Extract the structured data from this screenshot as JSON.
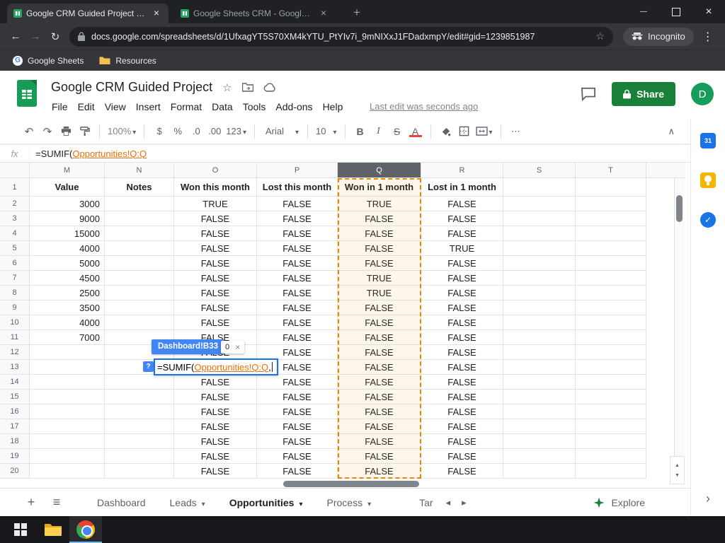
{
  "browser": {
    "tab1": "Google CRM Guided Project - Go",
    "tab2": "Google Sheets CRM - Google Sh",
    "url": "docs.google.com/spreadsheets/d/1UfxagYT5S70XM4kYTU_PtYIv7i_9mNIXxJ1FDadxmpY/edit#gid=1239851987",
    "incognito": "Incognito",
    "bookmark1": "Google Sheets",
    "bookmark2": "Resources"
  },
  "header": {
    "title": "Google CRM Guided Project",
    "menus": [
      "File",
      "Edit",
      "View",
      "Insert",
      "Format",
      "Data",
      "Tools",
      "Add-ons",
      "Help"
    ],
    "last_edit": "Last edit was seconds ago",
    "share": "Share",
    "avatar": "D"
  },
  "toolbar": {
    "zoom": "100%",
    "currency": "$",
    "percent": "%",
    "dec0": ".0",
    "dec00": ".00",
    "fmt123": "123",
    "font": "Arial",
    "size": "10",
    "bold": "B",
    "italic": "I",
    "strike": "S",
    "textcolor": "A",
    "more": "⋯"
  },
  "formula": {
    "fx": "fx",
    "prefix": "=SUMIF(",
    "ref": "Opportunities!Q:Q"
  },
  "editor": {
    "chip": "Dashboard!B33",
    "value": "0",
    "close": "×",
    "help": "?",
    "prefix": "=SUMIF(",
    "ref": "Opportunities!Q:Q",
    "suffix": ","
  },
  "grid": {
    "cols": [
      "M",
      "N",
      "O",
      "P",
      "Q",
      "R",
      "S",
      "T"
    ],
    "sel": "Q",
    "headers": [
      "Value",
      "Notes",
      "Won this month",
      "Lost this month",
      "Won in 1 month",
      "Lost in 1 month",
      "",
      ""
    ],
    "rows": [
      [
        2,
        "3000",
        "",
        "TRUE",
        "FALSE",
        "TRUE",
        "FALSE",
        "",
        ""
      ],
      [
        3,
        "9000",
        "",
        "FALSE",
        "FALSE",
        "FALSE",
        "FALSE",
        "",
        ""
      ],
      [
        4,
        "15000",
        "",
        "FALSE",
        "FALSE",
        "FALSE",
        "FALSE",
        "",
        ""
      ],
      [
        5,
        "4000",
        "",
        "FALSE",
        "FALSE",
        "FALSE",
        "TRUE",
        "",
        ""
      ],
      [
        6,
        "5000",
        "",
        "FALSE",
        "FALSE",
        "FALSE",
        "FALSE",
        "",
        ""
      ],
      [
        7,
        "4500",
        "",
        "FALSE",
        "FALSE",
        "TRUE",
        "FALSE",
        "",
        ""
      ],
      [
        8,
        "2500",
        "",
        "FALSE",
        "FALSE",
        "TRUE",
        "FALSE",
        "",
        ""
      ],
      [
        9,
        "3500",
        "",
        "FALSE",
        "FALSE",
        "FALSE",
        "FALSE",
        "",
        ""
      ],
      [
        10,
        "4000",
        "",
        "FALSE",
        "FALSE",
        "FALSE",
        "FALSE",
        "",
        ""
      ],
      [
        11,
        "7000",
        "",
        "FALSE",
        "FALSE",
        "FALSE",
        "FALSE",
        "",
        ""
      ],
      [
        12,
        "",
        "",
        "FALSE",
        "FALSE",
        "FALSE",
        "FALSE",
        "",
        ""
      ],
      [
        13,
        "",
        "",
        "",
        "FALSE",
        "FALSE",
        "FALSE",
        "",
        ""
      ],
      [
        14,
        "",
        "",
        "FALSE",
        "FALSE",
        "FALSE",
        "FALSE",
        "",
        ""
      ],
      [
        15,
        "",
        "",
        "FALSE",
        "FALSE",
        "FALSE",
        "FALSE",
        "",
        ""
      ],
      [
        16,
        "",
        "",
        "FALSE",
        "FALSE",
        "FALSE",
        "FALSE",
        "",
        ""
      ],
      [
        17,
        "",
        "",
        "FALSE",
        "FALSE",
        "FALSE",
        "FALSE",
        "",
        ""
      ],
      [
        18,
        "",
        "",
        "FALSE",
        "FALSE",
        "FALSE",
        "FALSE",
        "",
        ""
      ],
      [
        19,
        "",
        "",
        "FALSE",
        "FALSE",
        "FALSE",
        "FALSE",
        "",
        ""
      ],
      [
        20,
        "",
        "",
        "FALSE",
        "FALSE",
        "FALSE",
        "FALSE",
        "",
        ""
      ]
    ]
  },
  "sheetbar": {
    "tabs": [
      {
        "label": "Dashboard",
        "caret": false,
        "active": false
      },
      {
        "label": "Leads",
        "caret": true,
        "active": false
      },
      {
        "label": "Opportunities",
        "caret": true,
        "active": true
      },
      {
        "label": "Process",
        "caret": true,
        "active": false
      },
      {
        "label": "Tar",
        "caret": false,
        "active": false
      }
    ],
    "explore": "Explore"
  },
  "colors": {
    "accent_green": "#188038",
    "ref_orange": "#ea8600",
    "selection_blue": "#1a73e8"
  }
}
